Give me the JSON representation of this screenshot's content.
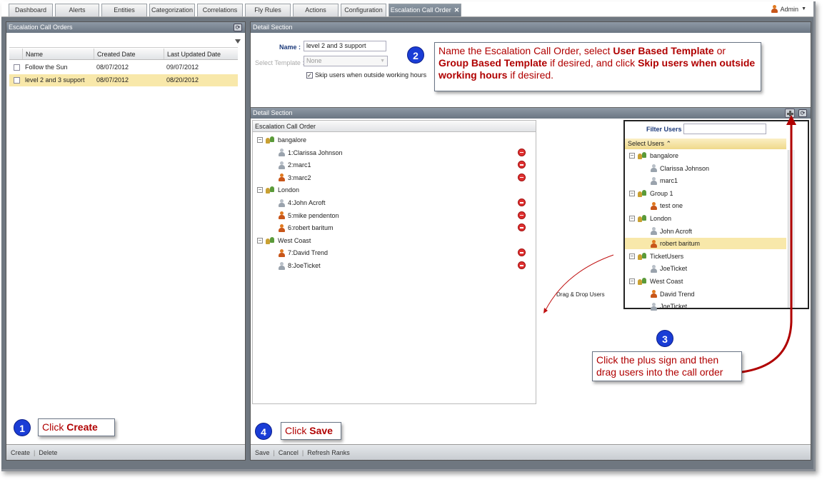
{
  "tabs": [
    {
      "label": "Dashboard"
    },
    {
      "label": "Alerts"
    },
    {
      "label": "Entities"
    },
    {
      "label": "Categorization"
    },
    {
      "label": "Correlations"
    },
    {
      "label": "Fly Rules"
    },
    {
      "label": "Actions"
    },
    {
      "label": "Configuration"
    },
    {
      "label": "Escalation Call Order"
    }
  ],
  "user": {
    "name": "Admin"
  },
  "left_panel": {
    "title": "Escalation Call Orders",
    "columns": [
      "Name",
      "Created Date",
      "Last Updated Date"
    ],
    "rows": [
      {
        "name": "Follow the Sun",
        "created": "08/07/2012",
        "updated": "09/07/2012"
      },
      {
        "name": "level 2 and 3 support",
        "created": "08/07/2012",
        "updated": "08/20/2012"
      }
    ],
    "footer": {
      "create": "Create",
      "delete": "Delete"
    }
  },
  "detail_top": {
    "title": "Detail Section",
    "name_label": "Name :",
    "name_value": "level 2 and 3 support",
    "template_label": "Select Template :",
    "template_value": "None",
    "skip_label": "Skip users when outside working hours"
  },
  "detail_bottom": {
    "title": "Detail Section",
    "tree_header": "Escalation Call Order",
    "groups": [
      {
        "name": "bangalore",
        "users": [
          {
            "label": "1:Clarissa Johnson",
            "kind": "gray"
          },
          {
            "label": "2:marc1",
            "kind": "gray"
          },
          {
            "label": "3:marc2",
            "kind": "orange"
          }
        ]
      },
      {
        "name": "London",
        "users": [
          {
            "label": "4:John Acroft",
            "kind": "gray"
          },
          {
            "label": "5:mike pendenton",
            "kind": "orange"
          },
          {
            "label": "6:robert baritum",
            "kind": "orange"
          }
        ]
      },
      {
        "name": "West Coast",
        "users": [
          {
            "label": "7:David Trend",
            "kind": "orange"
          },
          {
            "label": "8:JoeTicket",
            "kind": "gray"
          }
        ]
      }
    ],
    "drag_label": "Drag & Drop Users",
    "filter_label": "Filter Users :",
    "select_header": "Select Users ⌃",
    "select_tree": [
      {
        "name": "bangalore",
        "users": [
          {
            "label": "Clarissa Johnson",
            "kind": "gray"
          },
          {
            "label": "marc1",
            "kind": "gray"
          }
        ]
      },
      {
        "name": "Group 1",
        "users": [
          {
            "label": "test one",
            "kind": "orange"
          }
        ]
      },
      {
        "name": "London",
        "users": [
          {
            "label": "John Acroft",
            "kind": "gray"
          },
          {
            "label": "robert baritum",
            "kind": "orange",
            "selected": true
          }
        ]
      },
      {
        "name": "TicketUsers",
        "users": [
          {
            "label": "JoeTicket",
            "kind": "gray"
          }
        ]
      },
      {
        "name": "West Coast",
        "users": [
          {
            "label": "David Trend",
            "kind": "orange"
          },
          {
            "label": "JoeTicket",
            "kind": "gray"
          }
        ]
      }
    ],
    "footer": {
      "save": "Save",
      "cancel": "Cancel",
      "refresh_ranks": "Refresh Ranks"
    }
  },
  "callouts": {
    "c1": {
      "num": "1",
      "pre": "Click ",
      "bold": "Create"
    },
    "c2": {
      "num": "2",
      "t1": "Name the Escalation Call Order,  select ",
      "b1": "User Based Template",
      "t2": " or ",
      "b2": "Group Based Template",
      "t3": " if desired, and click ",
      "b3": "Skip users when outside working hours",
      "t4": " if desired."
    },
    "c3": {
      "num": "3",
      "text": "Click the plus sign and then drag users into the call order"
    },
    "c4": {
      "num": "4",
      "pre": "Click ",
      "bold": "Save"
    }
  },
  "colors": {
    "callout_text": "#b00000",
    "badge": "#1a3dd6",
    "selected_row": "#f8e8aa",
    "header": "#7a8591"
  }
}
